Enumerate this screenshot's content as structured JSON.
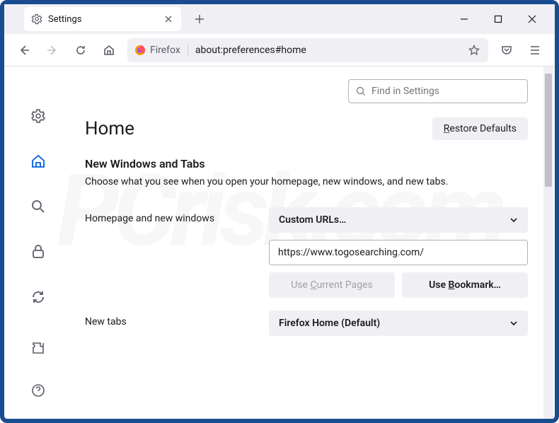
{
  "tab": {
    "title": "Settings"
  },
  "urlbar": {
    "brand": "Firefox",
    "url": "about:preferences#home"
  },
  "search": {
    "placeholder": "Find in Settings"
  },
  "page": {
    "heading": "Home",
    "restore": "Restore Defaults",
    "restore_char": "R",
    "restore_rest": "estore Defaults"
  },
  "section": {
    "title": "New Windows and Tabs",
    "desc": "Choose what you see when you open your homepage, new windows, and new tabs."
  },
  "homepage": {
    "label": "Homepage and new windows",
    "dropdown": "Custom URLs…",
    "url_value": "https://www.togosearching.com/",
    "use_current_char": "C",
    "use_current_pre": "Use ",
    "use_current_post": "urrent Pages",
    "use_bookmark_char": "B",
    "use_bookmark_pre": "Use ",
    "use_bookmark_post": "ookmark…"
  },
  "newtabs": {
    "label": "New tabs",
    "dropdown": "Firefox Home (Default)"
  }
}
